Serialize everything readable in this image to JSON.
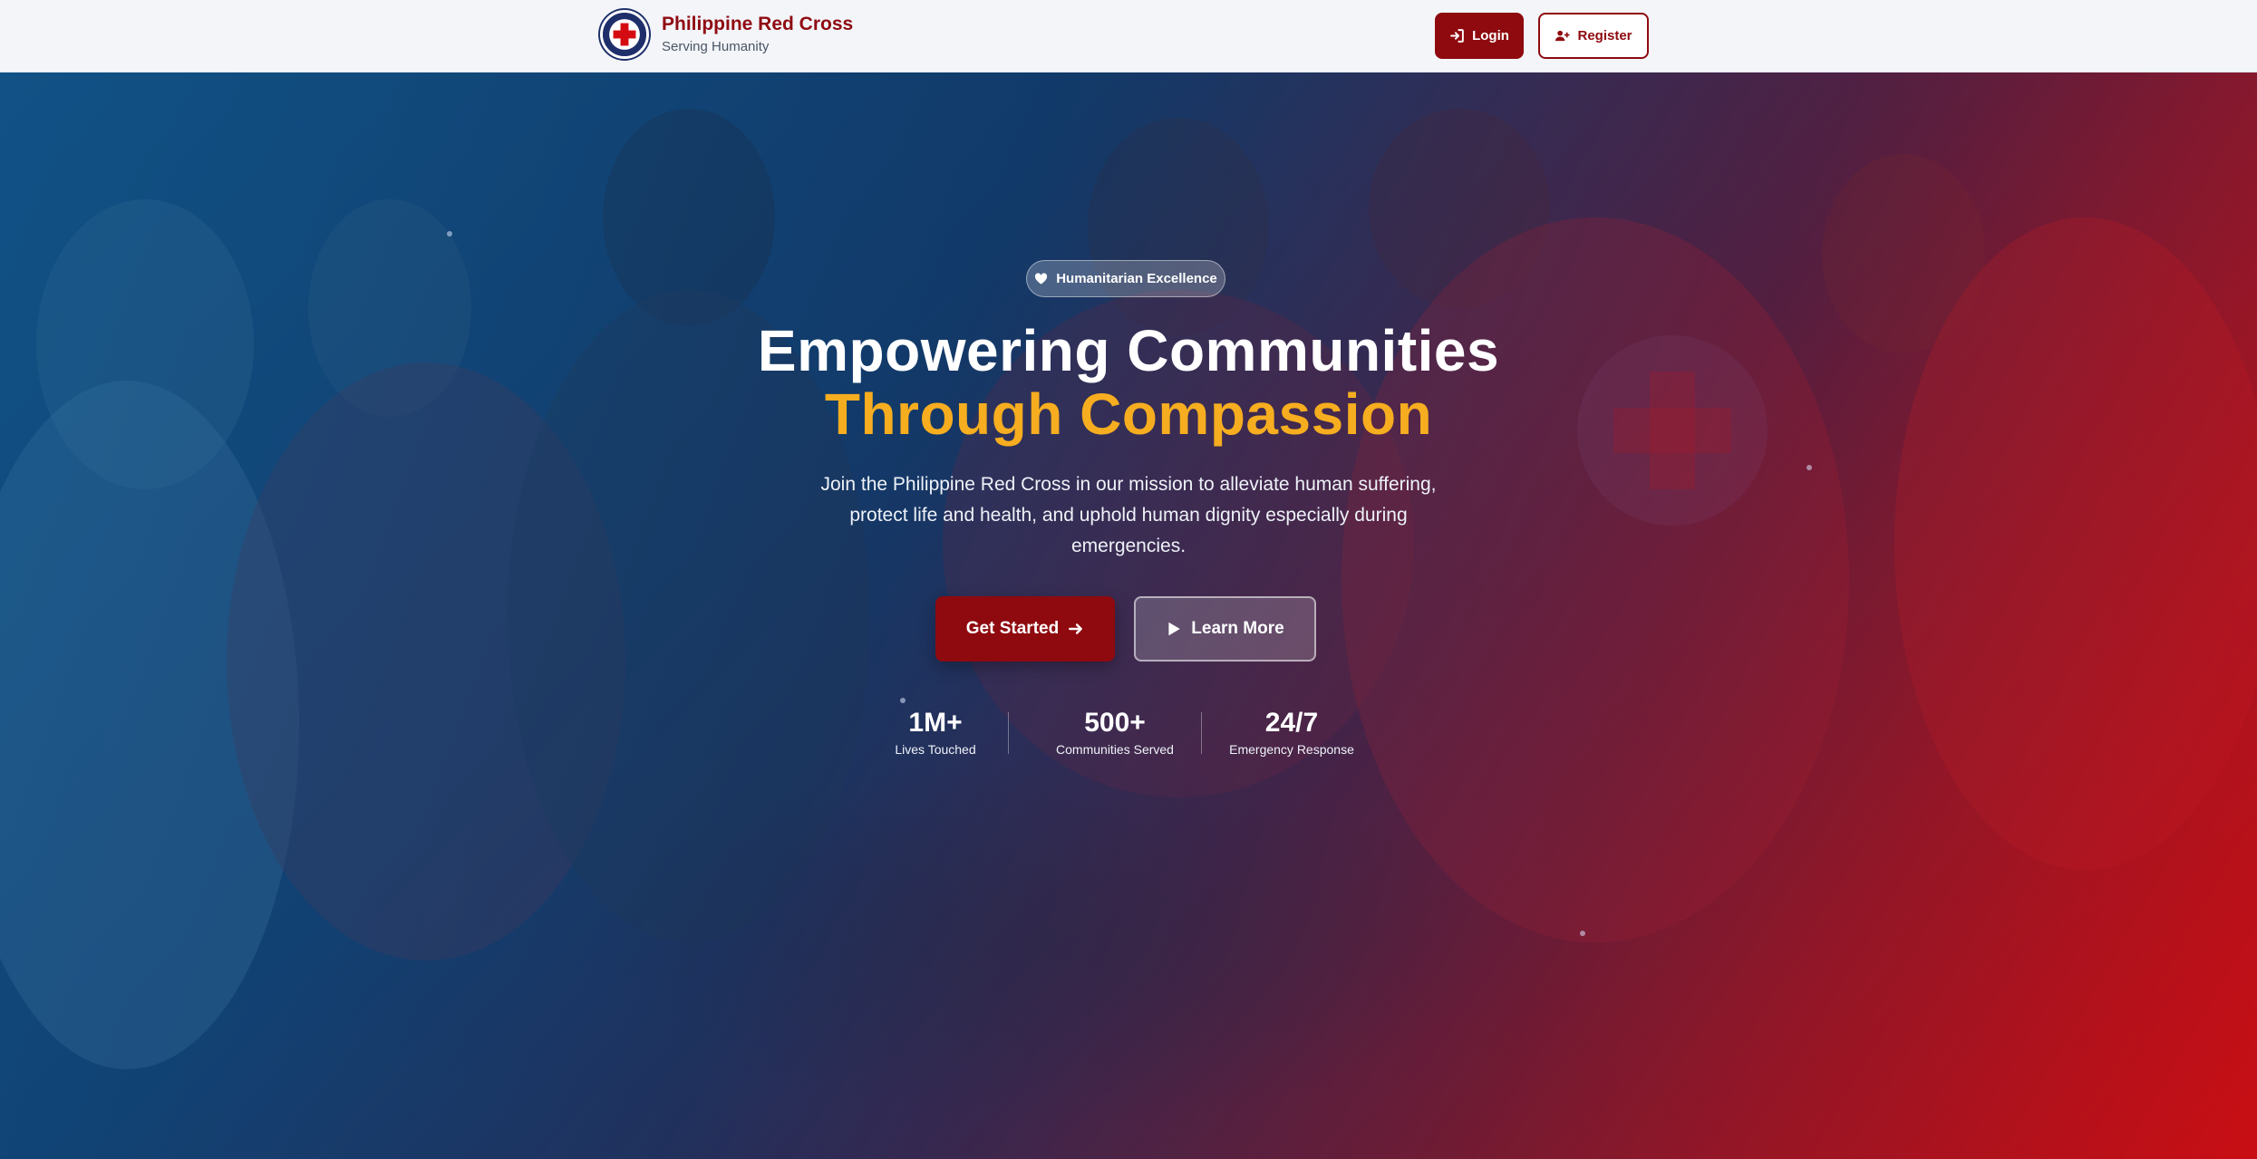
{
  "brand": {
    "title": "Philippine Red Cross",
    "subtitle": "Serving Humanity"
  },
  "nav": {
    "login_label": "Login",
    "register_label": "Register"
  },
  "hero": {
    "badge": "Humanitarian Excellence",
    "title_line1": "Empowering Communities",
    "title_line2": "Through Compassion",
    "description": "Join the Philippine Red Cross in our mission to alleviate human suffering, protect life and health, and uphold human dignity especially during emergencies.",
    "primary_cta": "Get Started",
    "secondary_cta": "Learn More",
    "stats": [
      {
        "value": "1M+",
        "label": "Lives Touched"
      },
      {
        "value": "500+",
        "label": "Communities Served"
      },
      {
        "value": "24/7",
        "label": "Emergency Response"
      }
    ]
  },
  "icons": {
    "login": "sign-in-icon",
    "register": "user-plus-icon",
    "badge": "heart-icon",
    "primary_cta": "arrow-right-icon",
    "secondary_cta": "play-icon"
  },
  "colors": {
    "brand_red": "#8e0a0f",
    "accent_gold": "#f6ad1f",
    "hero_blue": "#124e80",
    "hero_red": "#c80a0f"
  }
}
